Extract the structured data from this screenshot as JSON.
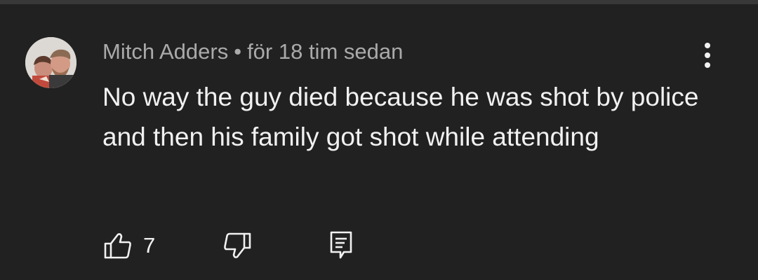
{
  "comment": {
    "author": "Mitch Adders",
    "separator": "•",
    "timestamp": "för 18 tim sedan",
    "text": "No way the guy died because he was shot by police and then his family got shot while attending",
    "like_count": "7"
  },
  "icons": {
    "menu": "more-vertical-icon",
    "like": "thumbs-up-icon",
    "dislike": "thumbs-down-icon",
    "reply": "reply-comment-icon"
  },
  "colors": {
    "background": "#212121",
    "primary_text": "#f1f1f1",
    "secondary_text": "#aaaaaa"
  }
}
